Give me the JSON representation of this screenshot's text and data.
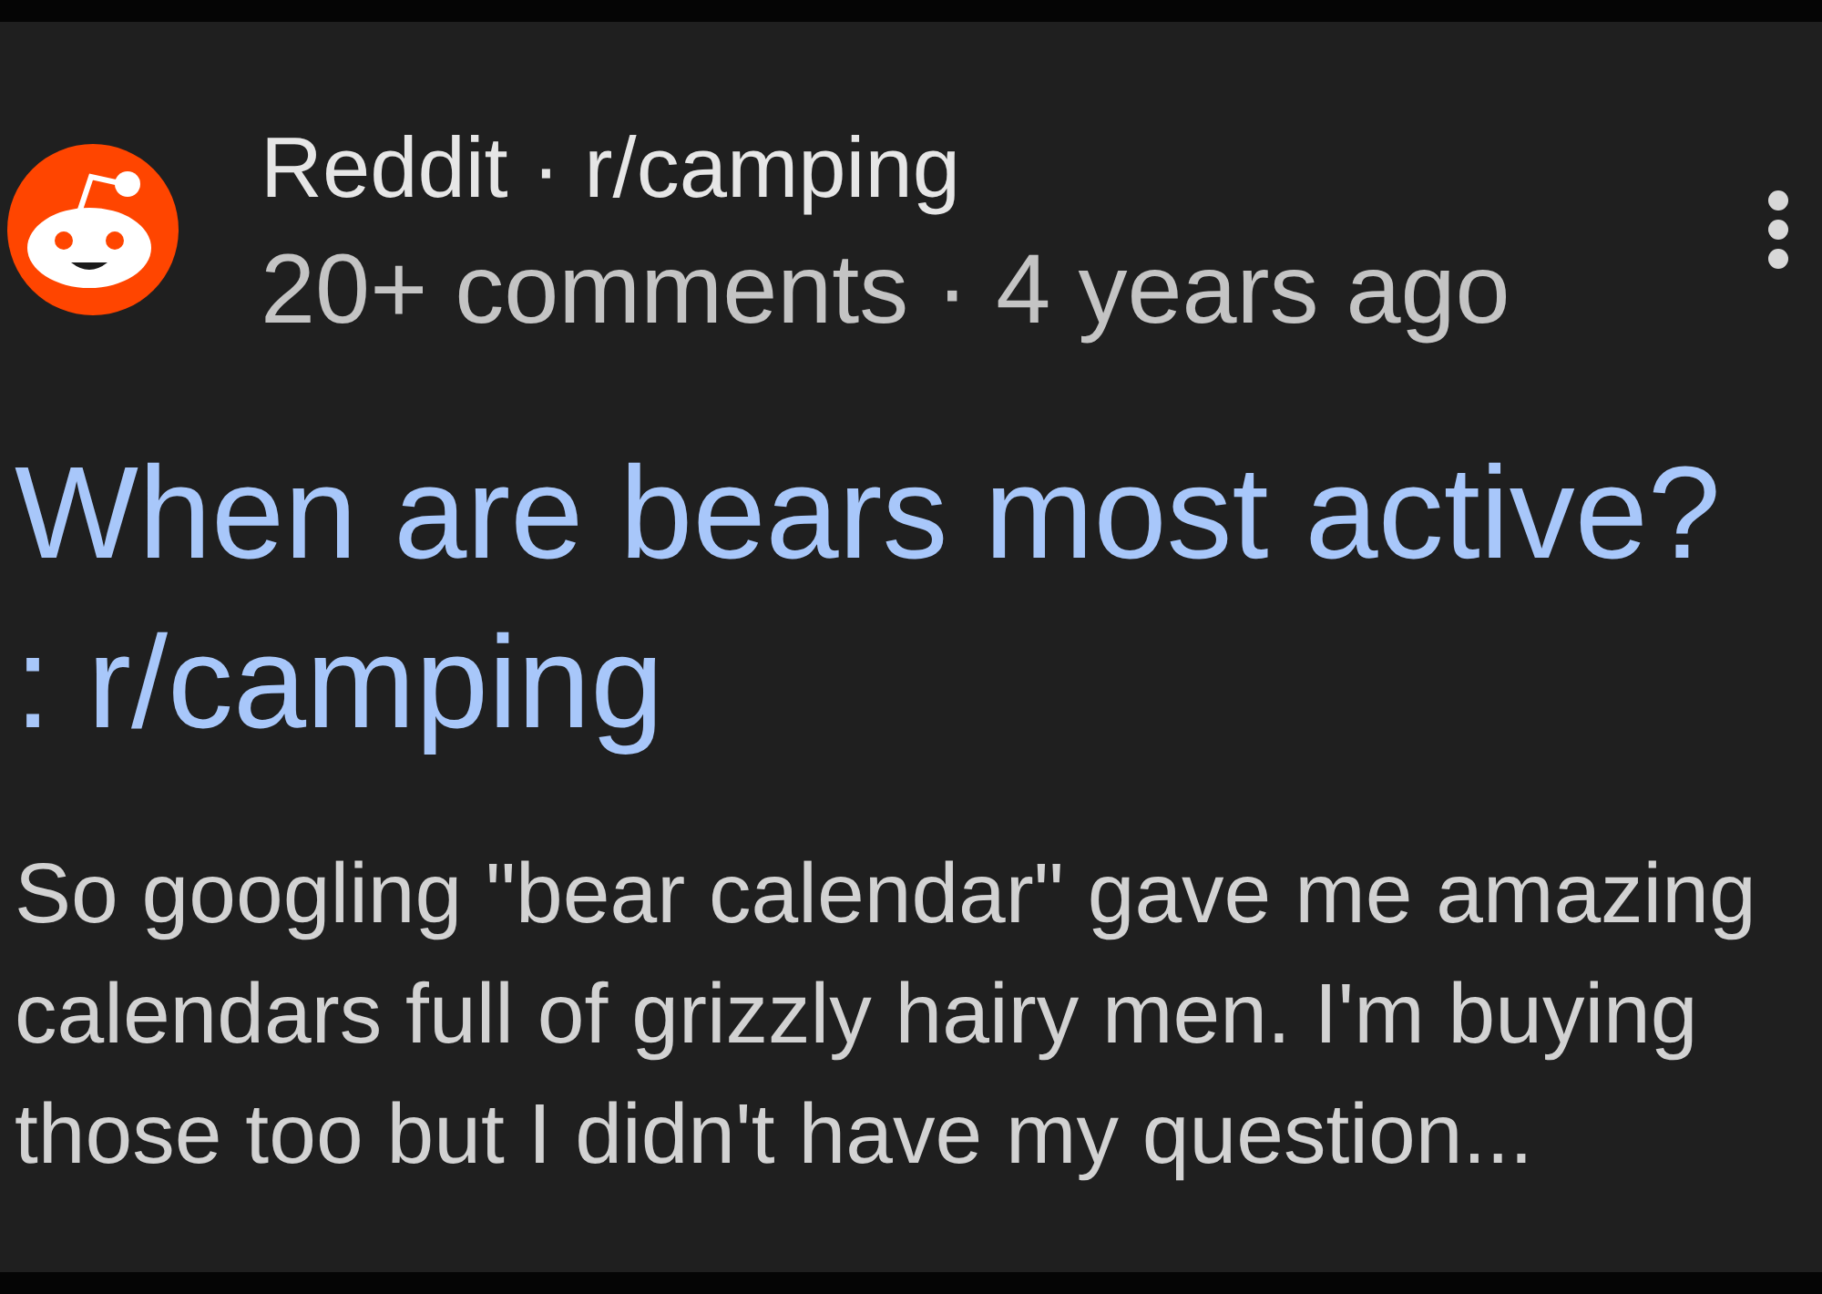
{
  "result": {
    "site_line": "Reddit · r/camping",
    "meta_line": "20+ comments · 4 years ago",
    "title": "When are bears most active? : r/camping",
    "snippet": "So googling \"bear calendar\" gave me amazing calendars full of grizzly hairy men. I'm buying those too but I didn't have my question..."
  }
}
